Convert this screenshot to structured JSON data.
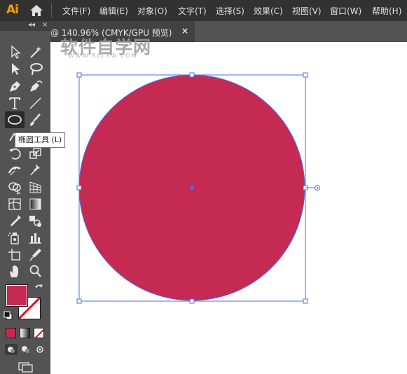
{
  "app": {
    "logo": "Ai",
    "menus": [
      "文件(F)",
      "编辑(E)",
      "对象(O)",
      "文字(T)",
      "选择(S)",
      "效果(C)",
      "视图(V)",
      "窗口(W)",
      "帮助(H)"
    ]
  },
  "document_tab": {
    "title": "@ 140.96% (CMYK/GPU 预览)",
    "close": "×"
  },
  "watermark": {
    "main": "软件自学网",
    "sub": "WWW.RJZXW.COM"
  },
  "toolbar": {
    "collapse": "◂◂",
    "close": "×"
  },
  "tooltip": {
    "text": "椭圆工具 (L)"
  },
  "colors": {
    "fill": "#c52a53",
    "selection": "#4a6cf0",
    "ui_dark": "#323232",
    "ui_mid": "#535353"
  },
  "icons": [
    "home-icon",
    "selection-tool-icon",
    "magic-wand-icon",
    "direct-selection-icon",
    "lasso-icon",
    "pen-tool-icon",
    "curvature-icon",
    "type-tool-icon",
    "line-tool-icon",
    "ellipse-tool-icon",
    "paintbrush-icon",
    "shaper-icon",
    "eraser-icon",
    "rotate-icon",
    "scale-icon",
    "width-tool-icon",
    "puppet-warp-icon",
    "shape-builder-icon",
    "perspective-grid-icon",
    "mesh-tool-icon",
    "gradient-tool-icon",
    "eyedropper-icon",
    "blend-tool-icon",
    "symbol-sprayer-icon",
    "column-graph-icon",
    "artboard-tool-icon",
    "slice-tool-icon",
    "hand-tool-icon",
    "zoom-tool-icon",
    "swap-colors-icon",
    "default-colors-icon",
    "color-mode-icon",
    "gradient-mode-icon",
    "none-mode-icon",
    "draw-normal-icon",
    "draw-behind-icon",
    "draw-inside-icon",
    "screen-mode-icon"
  ]
}
